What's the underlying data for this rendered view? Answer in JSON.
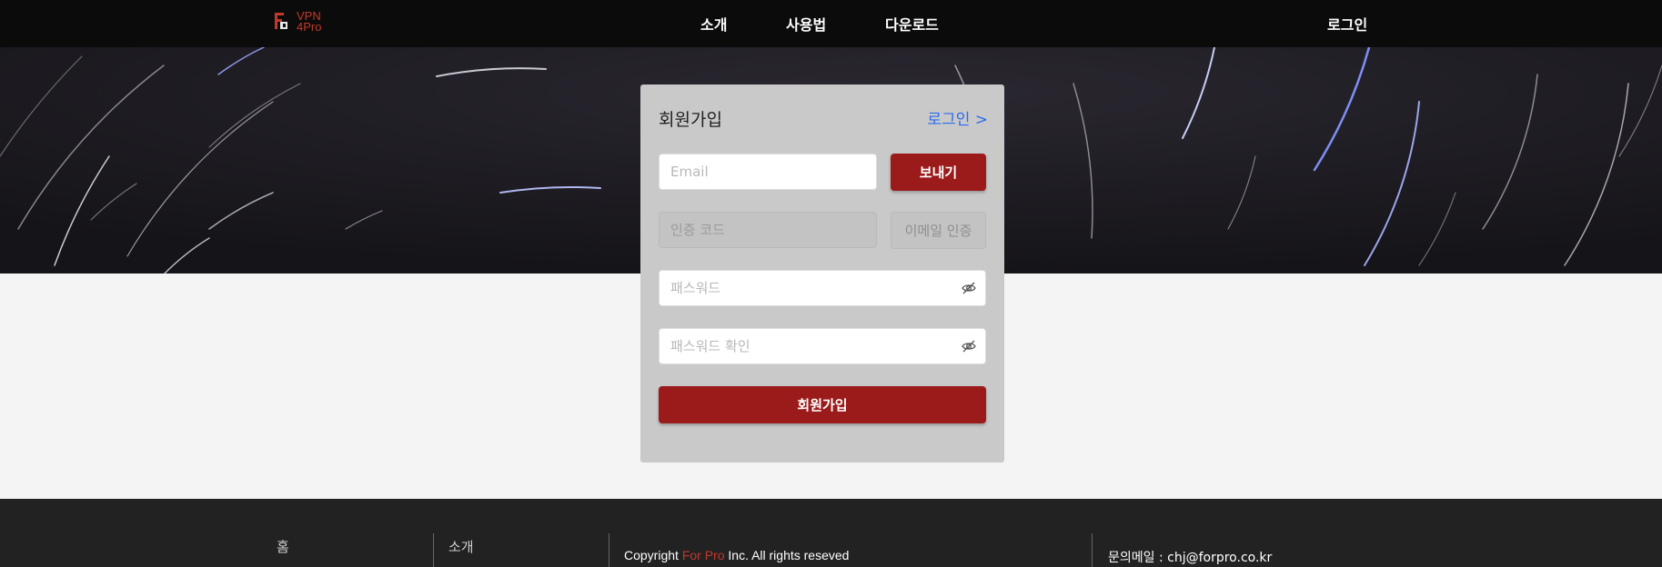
{
  "header": {
    "logo_text_line1": "VPN",
    "logo_text_line2": "4Pro",
    "nav": {
      "intro": "소개",
      "howto": "사용법",
      "download": "다운로드",
      "login": "로그인"
    }
  },
  "signup_form": {
    "title": "회원가입",
    "login_link": "로그인 >",
    "email_placeholder": "Email",
    "send_button": "보내기",
    "code_placeholder": "인증 코드",
    "verify_button": "이메일 인증",
    "password_placeholder": "패스워드",
    "password_confirm_placeholder": "패스워드 확인",
    "submit_button": "회원가입"
  },
  "footer": {
    "home": "홈",
    "intro": "소개",
    "copyright_prefix": "Copyright ",
    "copyright_brand": "For Pro",
    "copyright_suffix": " Inc. All rights reseved",
    "contact": "문의메일 : chj@forpro.co.kr"
  },
  "colors": {
    "accent": "#9b1b1b",
    "link": "#2b6cf0",
    "brand_red": "#c0392b"
  }
}
